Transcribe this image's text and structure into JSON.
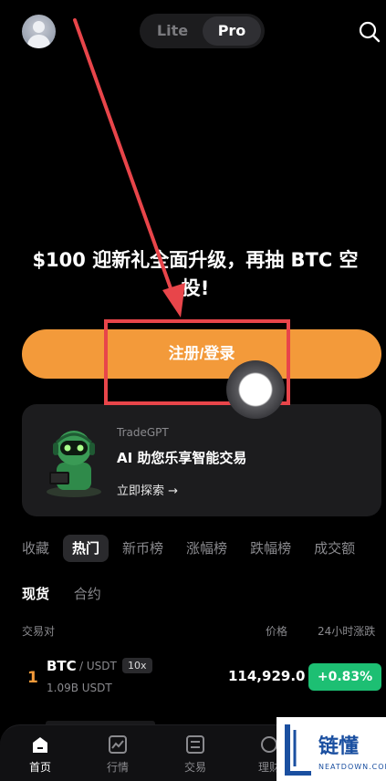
{
  "header": {
    "mode_options": [
      "Lite",
      "Pro"
    ],
    "mode_selected": "Pro"
  },
  "promo": {
    "headline": "$100 迎新礼全面升级，再抽 BTC 空投!",
    "cta_label": "注册/登录"
  },
  "tradegpt_card": {
    "brand": "TradeGPT",
    "title": "AI 助您乐享智能交易",
    "link": "立即探索 →"
  },
  "category_tabs": [
    "收藏",
    "热门",
    "新币榜",
    "涨幅榜",
    "跌幅榜",
    "成交额"
  ],
  "category_selected": "热门",
  "sub_tabs": [
    "现货",
    "合约"
  ],
  "sub_tab_selected": "现货",
  "table": {
    "columns": {
      "pair": "交易对",
      "price": "价格",
      "change": "24小时涨跌"
    },
    "rows": [
      {
        "rank": "1",
        "symbol": "BTC",
        "quote": "/ USDT",
        "leverage": "10x",
        "volume": "1.09B USDT",
        "price": "114,929.0",
        "change": "+0.83%"
      }
    ]
  },
  "bottom_nav": [
    {
      "label": "首页",
      "icon": "home-icon",
      "active": true
    },
    {
      "label": "行情",
      "icon": "chart-icon",
      "active": false
    },
    {
      "label": "交易",
      "icon": "trade-icon",
      "active": false
    },
    {
      "label": "理财",
      "icon": "finance-icon",
      "active": false
    }
  ],
  "watermark": {
    "text": "链懂",
    "subtext": "NEATDOWN.COM"
  },
  "colors": {
    "accent": "#f39a3a",
    "positive": "#1dbf73",
    "annotation": "#e8454a",
    "background": "#000000",
    "card": "#1c1c1e"
  }
}
